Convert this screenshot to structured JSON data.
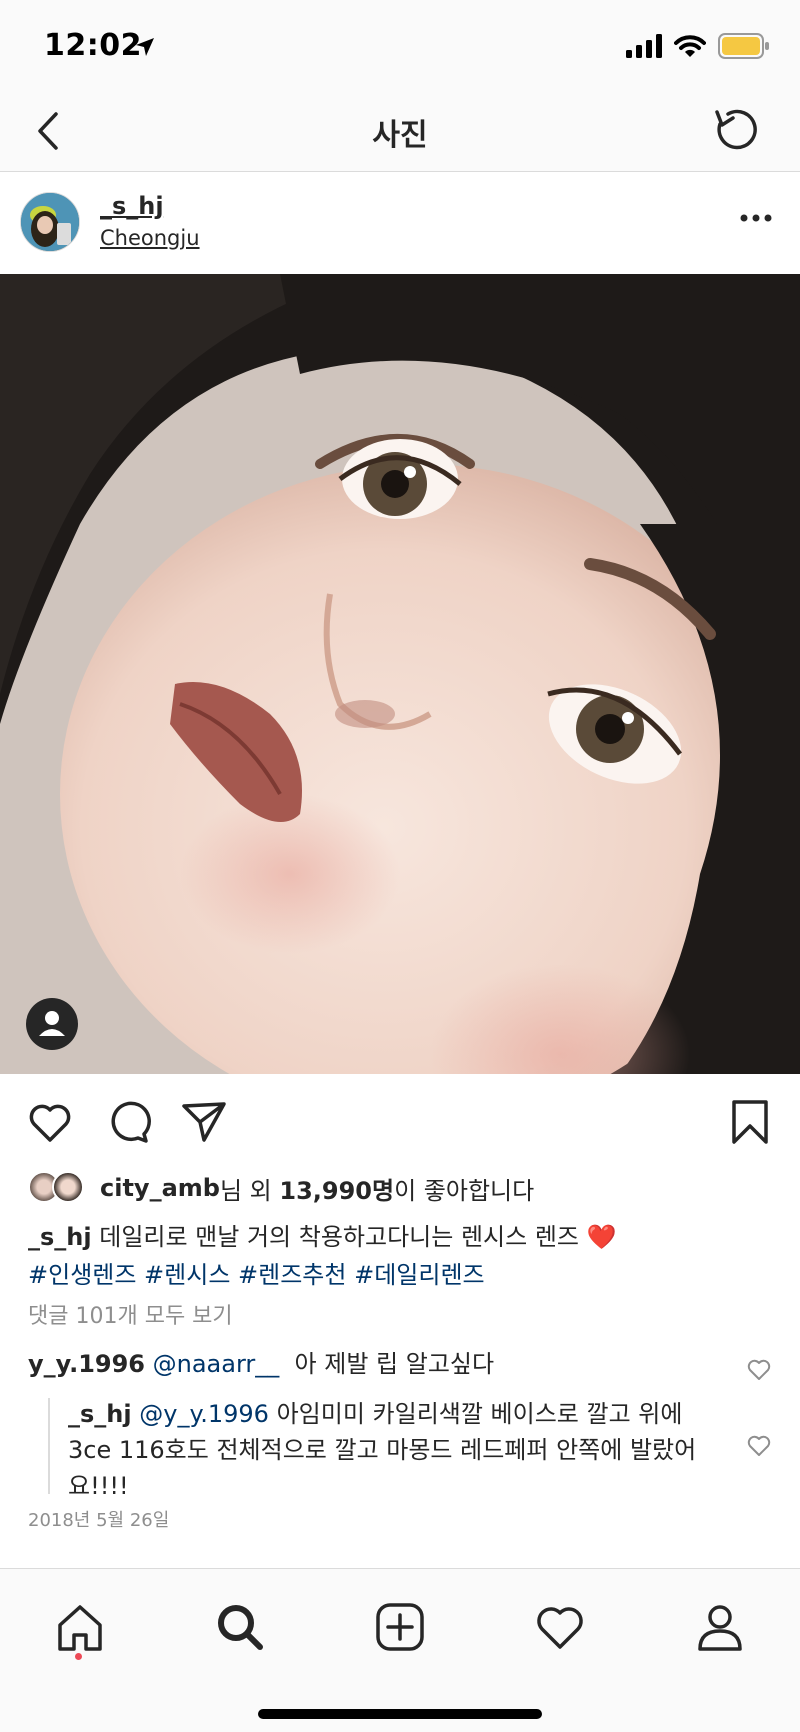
{
  "status": {
    "time": "12:02"
  },
  "nav": {
    "title": "사진"
  },
  "post": {
    "username": "_s_hj",
    "location": "Cheongju"
  },
  "likes": {
    "user": "city_amb",
    "suffix1": "님 외 ",
    "count": "13,990명",
    "suffix2": "이 좋아합니다"
  },
  "caption": {
    "username": "_s_hj",
    "text": " 데일리로 맨날 거의 착용하고다니는 렌시스 렌즈 ❤️",
    "hashtags": "#인생렌즈 #렌시스 #렌즈추천 #데일리렌즈"
  },
  "view_comments": "댓글 101개 모두 보기",
  "comments": [
    {
      "username": "y_y.1996",
      "mention": "@naaarr__",
      "text": "  아 제발 립 알고싶다"
    },
    {
      "username": "_s_hj",
      "mention": "@y_y.1996",
      "text": " 아임미미 카일리색깔 베이스로 깔고 위에 3ce 116호도 전체적으로 깔고 마몽드 레드페퍼 안쪽에 발랐어요!!!!"
    }
  ],
  "timestamp": "2018년 5월 26일",
  "icons": {
    "back": "chevron-left-icon",
    "refresh": "refresh-icon",
    "more": "more-icon",
    "like": "heart-icon",
    "comment": "comment-icon",
    "share": "send-icon",
    "save": "bookmark-icon",
    "home": "home-icon",
    "search": "search-icon",
    "add": "add-icon",
    "activity": "heart-icon",
    "profile": "profile-icon"
  },
  "colors": {
    "link": "#003569",
    "muted": "#8e8e8e",
    "notification": "#ed4956",
    "heart": "#e02b2b"
  }
}
